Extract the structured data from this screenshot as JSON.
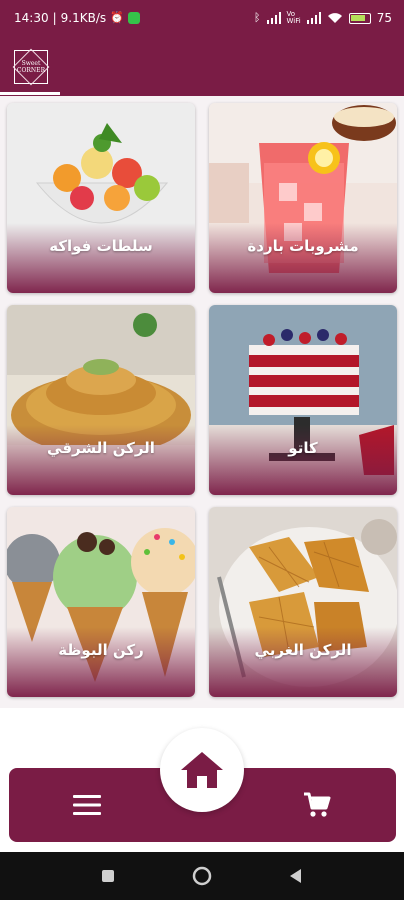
{
  "status_bar": {
    "time": "14:30",
    "network_speed": "9.1KB/s",
    "alarm_icon": "alarm-icon",
    "app_notification_icon": "whatsapp-icon",
    "bluetooth_icon": "bluetooth-icon",
    "signal_icons": [
      "signal-icon",
      "volte-icon",
      "signal-icon",
      "wifi-icon"
    ],
    "battery_percent": "75"
  },
  "header": {
    "logo_text_top": "Sweet",
    "logo_text_main": "CORNER",
    "brand_color": "#7a1c45"
  },
  "categories": [
    {
      "label": "مشروبات باردة",
      "image": "cold-drinks-image"
    },
    {
      "label": "سلطات فواكه",
      "image": "fruit-salad-image"
    },
    {
      "label": "كاتو",
      "image": "cake-image"
    },
    {
      "label": "الركن الشرقي",
      "image": "oriental-sweets-image"
    },
    {
      "label": "الركن الغربي",
      "image": "waffles-image"
    },
    {
      "label": "ركن البوظة",
      "image": "ice-cream-image"
    }
  ],
  "bottom_nav": {
    "menu_icon": "menu-icon",
    "home_icon": "home-icon",
    "cart_icon": "cart-icon"
  },
  "android_nav": {
    "back_icon": "back-triangle-icon",
    "home_icon": "home-circle-icon",
    "recent_icon": "recent-square-icon"
  }
}
